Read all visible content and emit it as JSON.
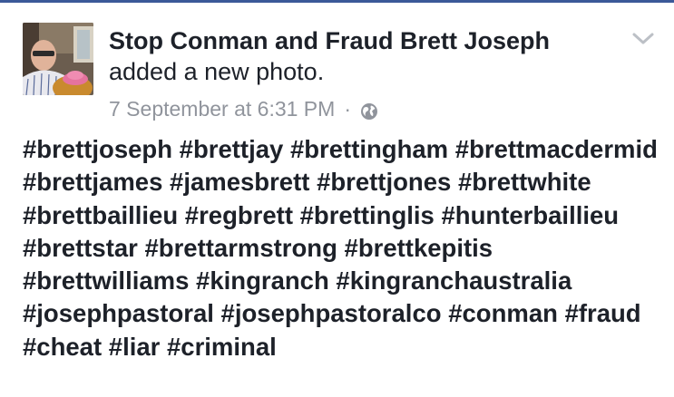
{
  "post": {
    "author": "Stop Conman and Fraud Brett Joseph",
    "action": "added a new photo.",
    "timestamp": "7 September at 6:31 PM",
    "separator": "·",
    "audience_icon": "globe-icon",
    "menu_icon": "chevron-down-icon",
    "avatar_icon": "profile-photo",
    "hashtags": [
      "#brettjoseph",
      "#brettjay",
      "#brettingham",
      "#brettmacdermid",
      "#brettjames",
      "#jamesbrett",
      "#brettjones",
      "#brettwhite",
      "#brettbaillieu",
      "#regbrett",
      "#brettinglis",
      "#hunterbaillieu",
      "#brettstar",
      "#brettarmstrong",
      "#brettkepitis",
      "#brettwilliams",
      "#kingranch",
      "#kingranchaustralia",
      "#josephpastoral",
      "#josephpastoralco",
      "#conman",
      "#fraud",
      "#cheat",
      "#liar",
      "#criminal"
    ]
  },
  "colors": {
    "text": "#1d2129",
    "meta": "#90949c",
    "brand_bar": "#3b5998"
  }
}
